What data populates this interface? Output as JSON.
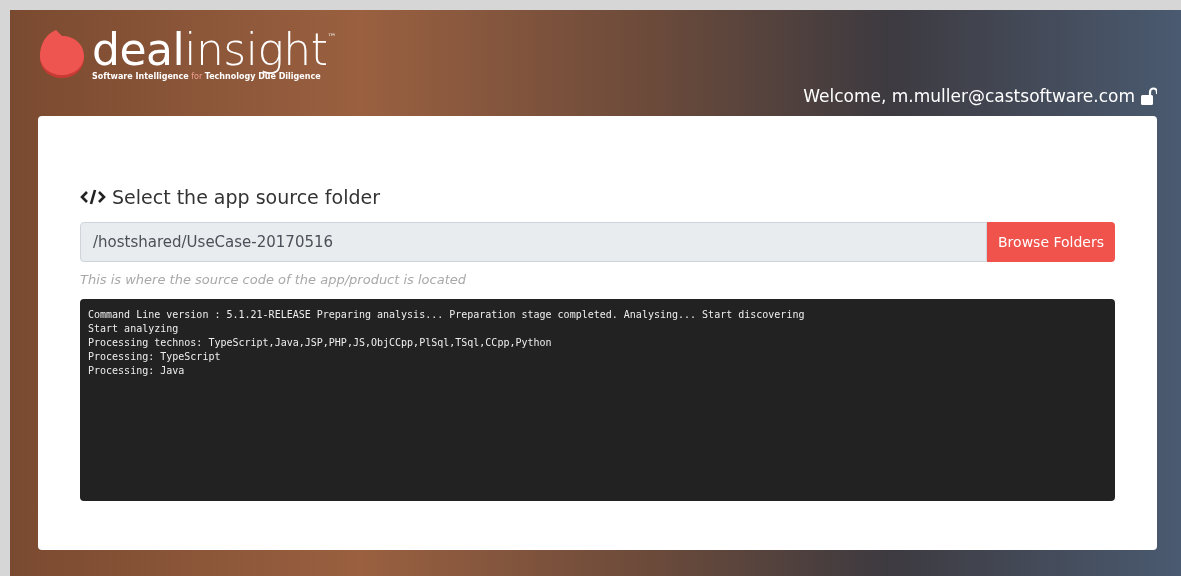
{
  "header": {
    "logo": "**deal**insight",
    "trademark": "™",
    "tagline": "**Software Intelligence** for **Technology Due Diligence**",
    "welcome": "Welcome, m.muller@castsoftware.com"
  },
  "panel": {
    "title": "Select the app source folder",
    "folder_field": {
      "value": "/hostshared/UseCase-20170516"
    },
    "browse_button": "Browse Folders",
    "hint": "This is where the source code of the app/product is located",
    "console_lines": [
      "Command Line version : 5.1.21-RELEASE Preparing analysis... Preparation stage completed. Analysing... Start discovering",
      "Start analyzing",
      "Processing technos: TypeScript,Java,JSP,PHP,JS,ObjCCpp,PlSql,TSql,CCpp,Python",
      "Processing: TypeScript",
      "Processing: Java"
    ]
  }
}
